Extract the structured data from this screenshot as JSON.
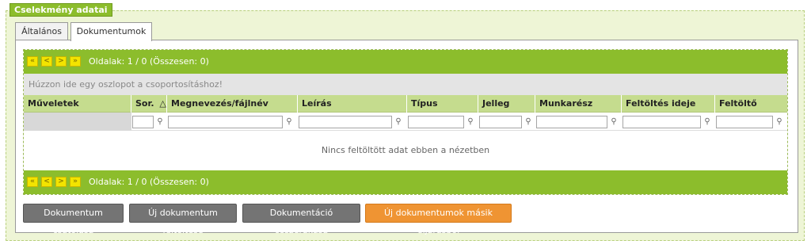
{
  "panel": {
    "legend": "Cselekmény adatai"
  },
  "tabs": [
    {
      "label": "Általános",
      "active": false
    },
    {
      "label": "Dokumentumok",
      "active": true
    }
  ],
  "pager": {
    "first": "«",
    "prev": "<",
    "next": ">",
    "last": "»",
    "info": "Oldalak: 1 / 0 (Összesen: 0)"
  },
  "grid": {
    "group_hint": "Húzzon ide egy oszlopot a csoportosításhoz!",
    "columns": [
      {
        "label": "Műveletek"
      },
      {
        "label": "Sor.",
        "sort": "△"
      },
      {
        "label": "Megnevezés/fájlnév"
      },
      {
        "label": "Leírás"
      },
      {
        "label": "Típus"
      },
      {
        "label": "Jelleg"
      },
      {
        "label": "Munkarész"
      },
      {
        "label": "Feltöltés ideje"
      },
      {
        "label": "Feltöltő"
      }
    ],
    "empty_message": "Nincs feltöltött adat ebben a nézetben",
    "filter_icon": "filter-icon"
  },
  "actions": {
    "attach": "Dokumentum csatolása",
    "upload": "Új dokumentum feltöltése",
    "compile": "Dokumentáció összerakása",
    "from_other": "Új dokumentumok másik eljárásból"
  },
  "colors": {
    "accent_green": "#8cbd2c",
    "header_green": "#c5dc8e",
    "button_gray": "#747474",
    "button_orange": "#ef9433",
    "pager_button_yellow": "#f3e400"
  }
}
